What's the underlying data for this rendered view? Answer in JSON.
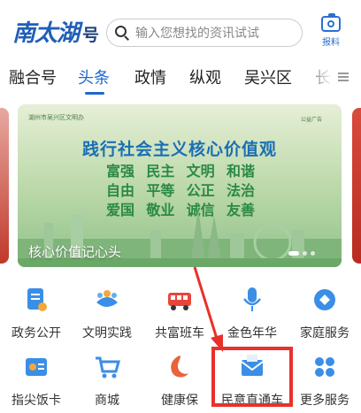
{
  "header": {
    "logo_main": "南太湖",
    "logo_sub": "号",
    "search_placeholder": "输入您想找的资讯试试",
    "report_label": "报料"
  },
  "tabs": [
    {
      "label": "融合号",
      "active": false
    },
    {
      "label": "头条",
      "active": true
    },
    {
      "label": "政情",
      "active": false
    },
    {
      "label": "纵观",
      "active": false
    },
    {
      "label": "吴兴区",
      "active": false
    },
    {
      "label": "长",
      "active": false
    }
  ],
  "banner": {
    "title": "践行社会主义核心价值观",
    "values": [
      [
        "富强",
        "民主",
        "文明",
        "和谐"
      ],
      [
        "自由",
        "平等",
        "公正",
        "法治"
      ],
      [
        "爱国",
        "敬业",
        "诚信",
        "友善"
      ]
    ],
    "caption": "核心价值记心头",
    "top_left_text": "湖州市吴兴区文明办",
    "top_right_text": "公益广告"
  },
  "services": [
    {
      "label": "政务公开",
      "icon": "gov-doc-icon"
    },
    {
      "label": "文明实践",
      "icon": "civilization-icon"
    },
    {
      "label": "共富班车",
      "icon": "bus-icon"
    },
    {
      "label": "金色年华",
      "icon": "microphone-icon"
    },
    {
      "label": "家庭服务",
      "icon": "family-service-icon"
    },
    {
      "label": "指尖饭卡",
      "icon": "meal-card-icon"
    },
    {
      "label": "商城",
      "icon": "shopping-cart-icon"
    },
    {
      "label": "健康保",
      "icon": "health-insurance-icon"
    },
    {
      "label": "民意直通车",
      "icon": "mail-icon"
    },
    {
      "label": "更多服务",
      "icon": "more-grid-icon"
    }
  ],
  "colors": {
    "brand_blue": "#1f66d1",
    "highlight_red": "#e8312a",
    "banner_green": "#2a8a45"
  }
}
